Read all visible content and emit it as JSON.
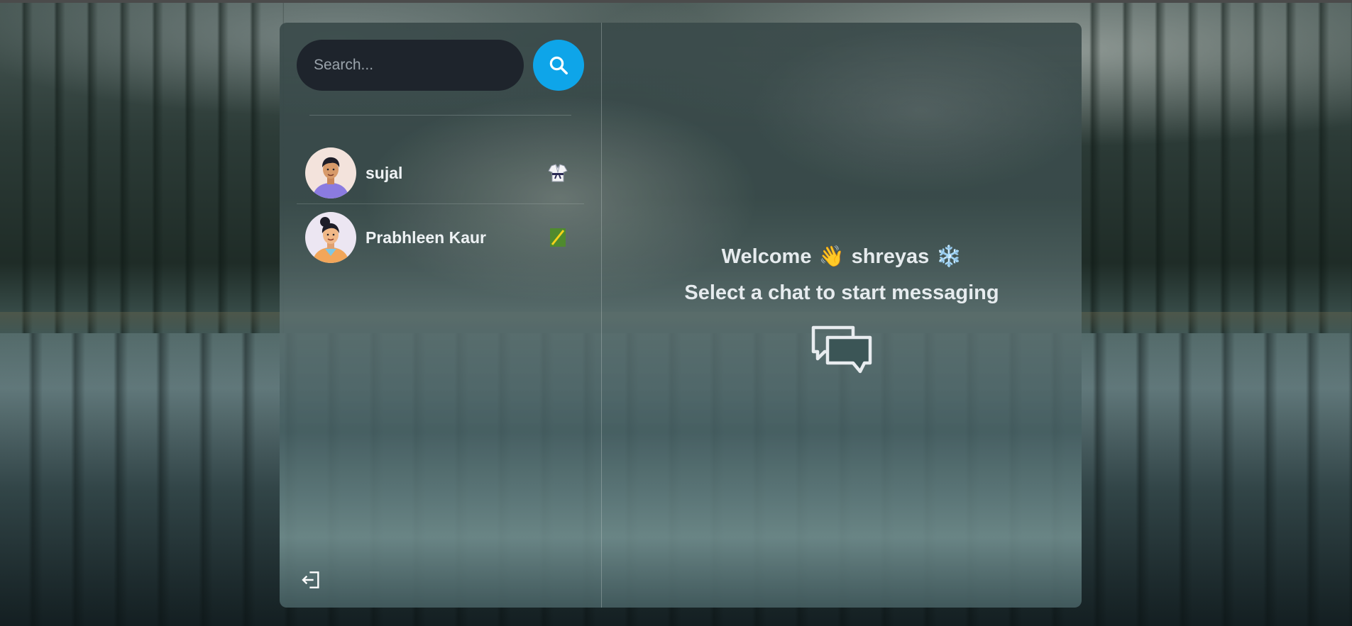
{
  "search": {
    "placeholder": "Search..."
  },
  "conversations": [
    {
      "name": "sujal",
      "emoji_icon": "martial-arts-uniform-icon"
    },
    {
      "name": "Prabhleen Kaur",
      "emoji_icon": "pole-vault-icon"
    }
  ],
  "welcome": {
    "greeting": "Welcome",
    "wave_emoji": "👋",
    "username": "shreyas",
    "snowflake_emoji": "❄️",
    "hint": "Select a chat to start messaging"
  },
  "icons": {
    "search": "search-icon",
    "logout": "logout-icon",
    "chat": "chat-bubbles-icon"
  },
  "colors": {
    "accent": "#0ea5e9",
    "search_bg": "#1e242c",
    "text": "#e6ebee"
  }
}
